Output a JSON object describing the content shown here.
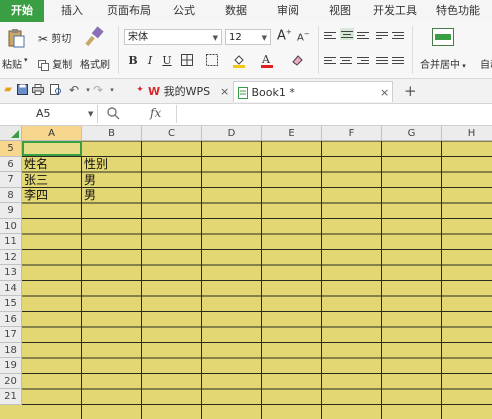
{
  "ribbon_tabs": [
    "开始",
    "插入",
    "页面布局",
    "公式",
    "数据",
    "审阅",
    "视图",
    "开发工具",
    "特色功能"
  ],
  "clipboard": {
    "paste": "粘贴",
    "cut": "剪切",
    "copy": "复制",
    "format_painter": "格式刷"
  },
  "font": {
    "name": "宋体",
    "size": "12",
    "grow": "A",
    "shrink": "A",
    "bold": "B",
    "italic": "I",
    "underline": "U"
  },
  "merge": {
    "label": "合并居中",
    "wrap_label": "自动"
  },
  "quick_access_icons": [
    "folder-icon",
    "save-icon",
    "print-icon",
    "print-preview-icon",
    "undo-icon",
    "redo-icon"
  ],
  "doc_tabs": [
    {
      "label": "我的WPS",
      "close": "×"
    },
    {
      "label": "Book1 *",
      "close": "×"
    }
  ],
  "new_tab": "+",
  "formula_bar": {
    "name_box": "A5",
    "fx": "fx",
    "value": ""
  },
  "columns": [
    "A",
    "B",
    "C",
    "D",
    "E",
    "F",
    "G",
    "H"
  ],
  "rows": [
    "5",
    "6",
    "7",
    "8",
    "9",
    "10",
    "11",
    "12",
    "13",
    "14",
    "15",
    "16",
    "17",
    "18",
    "19",
    "20",
    "21"
  ],
  "cells": [
    {
      "ref": "A6",
      "text": "姓名"
    },
    {
      "ref": "B6",
      "text": "性别"
    },
    {
      "ref": "A7",
      "text": "张三"
    },
    {
      "ref": "B7",
      "text": "男"
    },
    {
      "ref": "A8",
      "text": "李四"
    },
    {
      "ref": "B8",
      "text": "男"
    }
  ],
  "colors": {
    "accent": "#3a9e44",
    "sheet_fill": "#e3d774",
    "wps_red": "#d8282c"
  }
}
